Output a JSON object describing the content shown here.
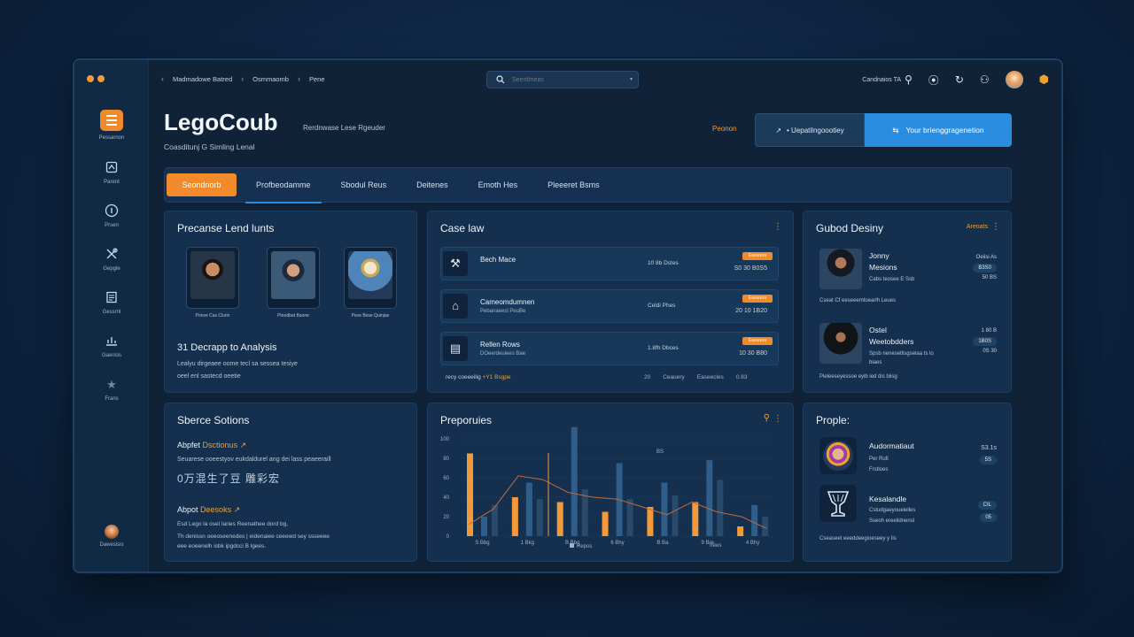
{
  "sidebar": {
    "items": [
      {
        "label": "Pessarnon",
        "icon": "menu-icon"
      },
      {
        "label": "Parent",
        "icon": "home-icon"
      },
      {
        "label": "Prsen",
        "icon": "info-icon"
      },
      {
        "label": "Gepgle",
        "icon": "tools-icon"
      },
      {
        "label": "Gessrnl",
        "icon": "document-icon"
      },
      {
        "label": "Gaensis",
        "icon": "analysis-icon"
      },
      {
        "label": "Frans",
        "icon": "star-icon"
      }
    ],
    "user_label": "Dawesisis"
  },
  "topbar": {
    "breadcrumb": [
      "Madmadowe Batred",
      "Osmmaomb",
      "Pene"
    ],
    "search_placeholder": "Seerdmeas",
    "right_label": "Candnaios TA",
    "icons": [
      "search-person-icon",
      "location-pin-icon",
      "refresh-icon",
      "person-icon",
      "user-avatar",
      "cube-icon"
    ]
  },
  "header": {
    "title": "LegoCoub",
    "subtitle": "Coasditunj G Simling Lenal",
    "tagline": "Rerdnwase Lese Rgeuder",
    "link_label": "Peonon",
    "button1_label": "• Uepatilngoootiey",
    "button2_label": "Your brienggragenetion"
  },
  "tabs": [
    "Seondnorb",
    "Profbeodamme",
    "Sbodul Reus",
    "Deitenes",
    "Emoth Hes",
    "Pleeeret Bsms"
  ],
  "precedents": {
    "title": "Precanse Lend lunts",
    "photos": [
      {
        "caption": "Prinse Cas Clurin"
      },
      {
        "caption": "Ptoodbat Baone"
      },
      {
        "caption": "Psoe Bese Quinjae"
      }
    ],
    "analysis_title": "31 Decrapp to Analysis",
    "analysis_line1": "Lealyu dirgeaee oome tecl sa sessea tesiye",
    "analysis_line2": "oeel enl sastecd oeetie"
  },
  "caselaw": {
    "title": "Case law",
    "rows": [
      {
        "name": "Bech Mace",
        "sub": "",
        "mid": "10 8b Dstes",
        "badge": "Eseerere",
        "value": "S0 30 B0S5"
      },
      {
        "name": "Cameomdumnen",
        "sub": "Pebanaeesl PeuBe",
        "mid": "Celdi Phes",
        "badge": "Eseerere",
        "value": "20 10 1B20"
      },
      {
        "name": "Rellen Rows",
        "sub": "DOeerdeuiees Bae",
        "mid": "1.8fh Dbces",
        "badge": "Eseerere",
        "value": "10 30 B80"
      }
    ],
    "footer_left": "recy coeeeilig",
    "footer_accent": "+Y1 Bsgpe",
    "footer_items": [
      "20",
      "Ceauery",
      "Easeecles",
      "0.83"
    ]
  },
  "sources": {
    "title": "Sberce Sotions",
    "item1_title": "Abpfet",
    "item1_accent": "Dsctionus",
    "item1_line": "Seuarese ooeestyov eukdaldurel ang dei lass peaeeraill",
    "item1_cjk": "0万混生了豆 雕彩宏",
    "item2_title": "Abpot",
    "item2_accent": "Deesoks",
    "item2_line1": "Esd Lego la osel Iaries Reenathee dord bg,",
    "item2_line2": "Th denissn oeeoseenedes | eidenaiee ceeewd sey ssseeee",
    "item2_line3": "eee eoeenelh isbk ipgdcci B lgees."
  },
  "guided": {
    "title": "Gubod Desiny",
    "action": "Areoats",
    "people": [
      {
        "name_line1": "Jonny",
        "name_line2": "Mesions",
        "sub": "Cabs teosee E Ssb",
        "stat1": "Oeiisi As",
        "stat2": "B3S0",
        "stat3": "50 BS",
        "note": "Cseat Cf eeseeemtoearlh Leues"
      },
      {
        "name_line1": "Ostel",
        "name_line2": "Weetobdders",
        "sub": "Spsb nenesetlisgselaa ts lo",
        "sub2": "biaes",
        "stat1": "1 80 B",
        "stat2": "1B0S",
        "stat3": "0S 30",
        "note": "Pieleeseyessoe eyib ied dis biisg"
      }
    ]
  },
  "properties": {
    "title": "Preporuies",
    "legend_label": "Repos",
    "legend_right": "Irees",
    "chart_title_icon": "person-icon"
  },
  "chart_data": {
    "type": "bar",
    "title": "",
    "ylim": [
      0,
      100
    ],
    "y_ticks": [
      "0",
      "20",
      "40",
      "60",
      "80",
      "100"
    ],
    "categories": [
      "S Bbg",
      "1 Bkg",
      "B Bbg",
      "6 Bhy",
      "B Ba",
      "9 Bre",
      "4 Bhy"
    ],
    "series": [
      {
        "color": "#f29a3a",
        "values": [
          85,
          40,
          35,
          25,
          30,
          35,
          10
        ]
      },
      {
        "color": "#2f5e8a",
        "values": [
          20,
          55,
          112,
          75,
          55,
          78,
          32
        ]
      },
      {
        "color": "#2a4a6c",
        "values": [
          32,
          38,
          48,
          38,
          42,
          58,
          20
        ]
      }
    ],
    "line": [
      12,
      28,
      62,
      58,
      45,
      40,
      38,
      30,
      22,
      35,
      25,
      20,
      8
    ],
    "annotation": "BS"
  },
  "people_panel": {
    "title": "Prople:",
    "people": [
      {
        "name": "Audormatiaut",
        "sub1": "Per Rufi",
        "sub2": "Frstloes",
        "stat1": "S3.1s",
        "stat2": "5S"
      },
      {
        "name": "Kesalandle",
        "sub1": "Cstudgaeyouelelles",
        "sub2": "Sseoh ereelidnensl",
        "stat1": "CIL",
        "stat2": "05"
      }
    ],
    "footer": "Cseaseet eeeddeegioeseey y Iis"
  },
  "colors": {
    "accent": "#f08a2a",
    "primary": "#2a8de0",
    "panel": "#14304e",
    "background": "#0d2440"
  }
}
